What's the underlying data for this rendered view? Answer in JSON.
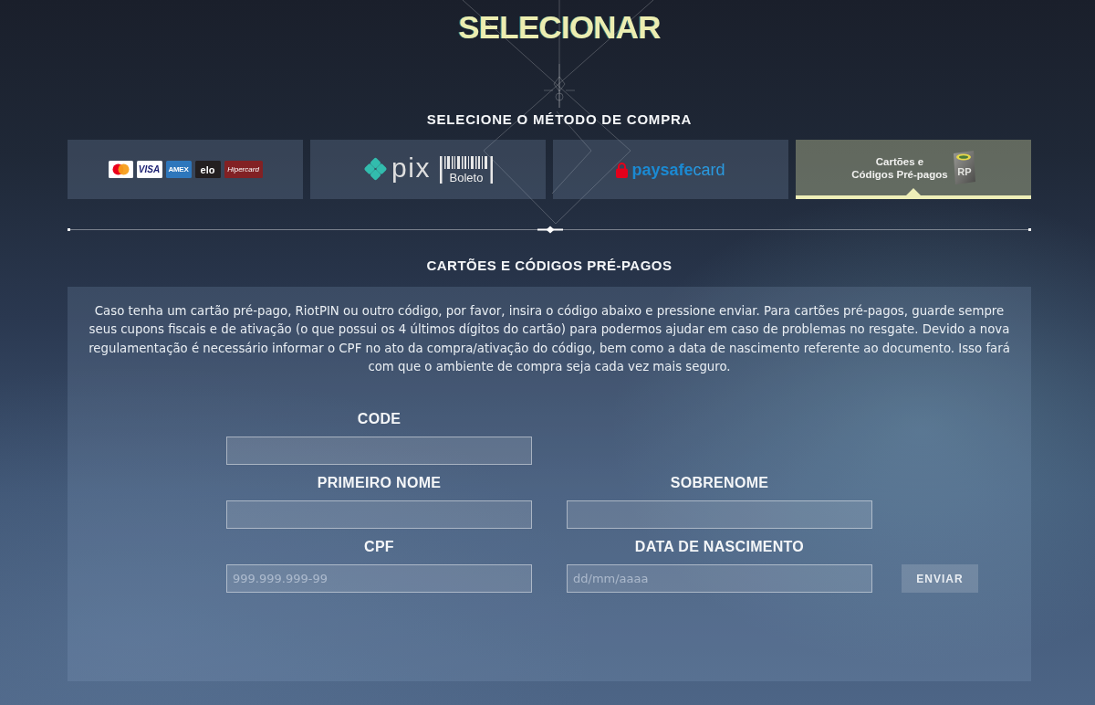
{
  "title": "SELECIONAR",
  "method_section": {
    "heading": "SELECIONE O MÉTODO DE COMPRA",
    "methods": [
      {
        "selected": false,
        "logos": [
          {
            "kind": "mastercard"
          },
          {
            "kind": "visa",
            "text": "VISA"
          },
          {
            "kind": "amex",
            "text": "AMEX"
          },
          {
            "kind": "elo",
            "text": "elo"
          },
          {
            "kind": "hipercard",
            "text": "Hipercard"
          }
        ]
      },
      {
        "selected": false,
        "logos": [
          {
            "kind": "pix",
            "text": "pix"
          },
          {
            "kind": "boleto",
            "text": "Boleto"
          }
        ]
      },
      {
        "selected": false,
        "logos": [
          {
            "kind": "paysafecard",
            "text": "paysafe",
            "text_2": "card"
          }
        ]
      },
      {
        "selected": true,
        "label_lines": [
          "Cartões e",
          "Códigos Pré-pagos"
        ],
        "logos": [
          {
            "kind": "rp_card",
            "text": "RP"
          }
        ]
      }
    ]
  },
  "prepaid_section": {
    "heading": "CARTÕES E CÓDIGOS PRÉ-PAGOS",
    "description": "Caso tenha um cartão pré-pago, RiotPIN ou outro código, por favor, insira o código abaixo e pressione enviar. Para cartões pré-pagos, guarde sempre seus cupons fiscais e de ativação (o que possui os 4 últimos dígitos do cartão) para podermos ajudar em caso de problemas no resgate. Devido a nova regulamentação é necessário informar o CPF no ato da compra/ativação do código, bem como a data de nascimento referente ao documento. Isso fará com que o ambiente de compra seja cada vez mais seguro.",
    "form": {
      "rows": [
        [
          {
            "label": "CODE"
          }
        ],
        [
          {
            "label": "PRIMEIRO NOME"
          },
          {
            "label": "SOBRENOME"
          }
        ],
        [
          {
            "label": "CPF",
            "placeholder": "999.999.999-99"
          },
          {
            "label": "DATA DE NASCIMENTO",
            "placeholder": "dd/mm/aaaa"
          }
        ]
      ],
      "submit_button": "ENVIAR"
    }
  }
}
